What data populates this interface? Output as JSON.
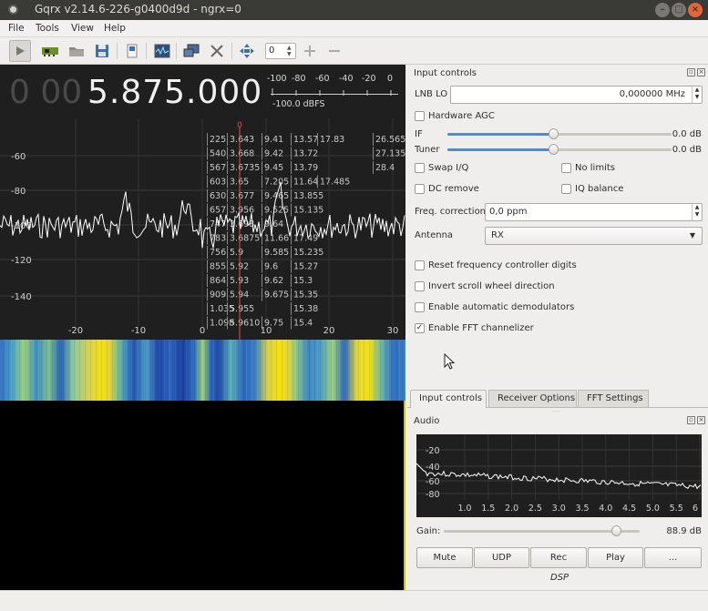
{
  "window": {
    "title": "Gqrx v2.14.6-226-g0400d9d - ngrx=0"
  },
  "menu": [
    "File",
    "Tools",
    "View",
    "Help"
  ],
  "toolbar": {
    "zoom_value": "0"
  },
  "frequency": {
    "dim_digits": "0 00",
    "main_digits": "5.875.000"
  },
  "meter": {
    "ticks": [
      "-100",
      "-80",
      "-60",
      "-40",
      "-20",
      "0"
    ],
    "readout": "-100.0 dBFS"
  },
  "plot": {
    "y_labels": [
      "-60",
      "-80",
      "-100",
      "-120",
      "-140"
    ],
    "x_labels": [
      "-20",
      "-10",
      "0",
      "10",
      "20",
      "30"
    ],
    "center_marker": "0",
    "overlay_rows": [
      [
        "225",
        "3.643",
        "9.41",
        "13.57",
        "17.83",
        "26.565"
      ],
      [
        "540",
        "3.668",
        "9.42",
        "13.72",
        "",
        "27.135"
      ],
      [
        "567",
        "3.6735",
        "9.45",
        "13.79",
        "",
        "28.4"
      ],
      [
        "603",
        "3.65",
        "7.205",
        "11.64",
        "17.485",
        ""
      ],
      [
        "630",
        "3.677",
        "9.465",
        "13.855",
        "",
        ""
      ],
      [
        "657",
        "3.956",
        "9.525",
        "15.135",
        "",
        ""
      ],
      [
        "747",
        "3.698",
        "9.64",
        "",
        "",
        ""
      ],
      [
        "783",
        "3.6875",
        "11.66",
        "17.49",
        "",
        ""
      ],
      [
        "756",
        "5.9",
        "9.585",
        "15.235",
        "",
        ""
      ],
      [
        "855",
        "5.92",
        "9.6",
        "15.27",
        "",
        ""
      ],
      [
        "864",
        "5.93",
        "9.62",
        "15.3",
        "",
        ""
      ],
      [
        "909",
        "5.94",
        "9.675",
        "15.35",
        "",
        ""
      ],
      [
        "1.035",
        "5.955",
        "",
        "15.38",
        "",
        ""
      ],
      [
        "1.098",
        "5.9610",
        "9.75",
        "15.4",
        "",
        ""
      ]
    ]
  },
  "input_controls": {
    "title": "Input controls",
    "lnb_lo_label": "LNB LO",
    "lnb_lo_value": "0,000000 MHz",
    "hardware_agc": "Hardware AGC",
    "if_label": "IF",
    "if_value": "0.0 dB",
    "if_level": 0.47,
    "tuner_label": "Tuner",
    "tuner_value": "0.0 dB",
    "tuner_level": 0.47,
    "swap_iq": "Swap I/Q",
    "no_limits": "No limits",
    "dc_remove": "DC remove",
    "iq_balance": "IQ balance",
    "freq_corr_label": "Freq. correction",
    "freq_corr_value": "0,0 ppm",
    "antenna_label": "Antenna",
    "antenna_value": "RX",
    "reset_digits": "Reset frequency controller digits",
    "invert_scroll": "Invert scroll wheel direction",
    "auto_demod": "Enable automatic demodulators",
    "fft_channelizer": "Enable FFT channelizer",
    "fft_channelizer_checked": true
  },
  "tabs": [
    "Input controls",
    "Receiver Options",
    "FFT Settings"
  ],
  "audio": {
    "title": "Audio",
    "y_labels": [
      "-20",
      "-40",
      "-60",
      "-80"
    ],
    "x_labels": [
      "1.0",
      "1.5",
      "2.0",
      "2.5",
      "3.0",
      "3.5",
      "4.0",
      "4.5",
      "5.0",
      "5.5",
      "6"
    ],
    "gain_label": "Gain:",
    "gain_value": "88.9 dB",
    "gain_level": 0.88,
    "buttons": [
      "Mute",
      "UDP",
      "Rec",
      "Play",
      "..."
    ],
    "dsp_label": "DSP"
  }
}
